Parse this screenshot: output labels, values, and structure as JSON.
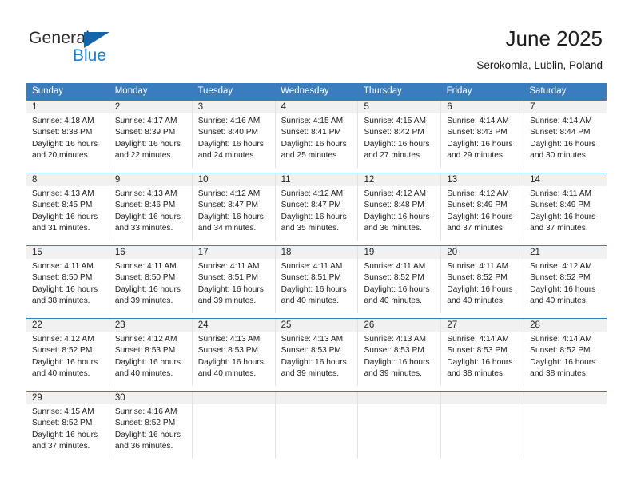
{
  "brand": {
    "name_top": "General",
    "name_bottom": "Blue",
    "triangle_color": "#1464aa",
    "blue_color": "#1a7fd4"
  },
  "header": {
    "title": "June 2025",
    "location": "Serokomla, Lublin, Poland"
  },
  "theme": {
    "header_bg": "#3a7dbf",
    "header_text": "#ffffff",
    "day_band_bg": "#f1f1f1",
    "cell_divider": "#e2e2e2"
  },
  "weekdays": [
    "Sunday",
    "Monday",
    "Tuesday",
    "Wednesday",
    "Thursday",
    "Friday",
    "Saturday"
  ],
  "weeks": [
    [
      {
        "day": "1",
        "sunrise": "Sunrise: 4:18 AM",
        "sunset": "Sunset: 8:38 PM",
        "daylight_1": "Daylight: 16 hours",
        "daylight_2": "and 20 minutes."
      },
      {
        "day": "2",
        "sunrise": "Sunrise: 4:17 AM",
        "sunset": "Sunset: 8:39 PM",
        "daylight_1": "Daylight: 16 hours",
        "daylight_2": "and 22 minutes."
      },
      {
        "day": "3",
        "sunrise": "Sunrise: 4:16 AM",
        "sunset": "Sunset: 8:40 PM",
        "daylight_1": "Daylight: 16 hours",
        "daylight_2": "and 24 minutes."
      },
      {
        "day": "4",
        "sunrise": "Sunrise: 4:15 AM",
        "sunset": "Sunset: 8:41 PM",
        "daylight_1": "Daylight: 16 hours",
        "daylight_2": "and 25 minutes."
      },
      {
        "day": "5",
        "sunrise": "Sunrise: 4:15 AM",
        "sunset": "Sunset: 8:42 PM",
        "daylight_1": "Daylight: 16 hours",
        "daylight_2": "and 27 minutes."
      },
      {
        "day": "6",
        "sunrise": "Sunrise: 4:14 AM",
        "sunset": "Sunset: 8:43 PM",
        "daylight_1": "Daylight: 16 hours",
        "daylight_2": "and 29 minutes."
      },
      {
        "day": "7",
        "sunrise": "Sunrise: 4:14 AM",
        "sunset": "Sunset: 8:44 PM",
        "daylight_1": "Daylight: 16 hours",
        "daylight_2": "and 30 minutes."
      }
    ],
    [
      {
        "day": "8",
        "sunrise": "Sunrise: 4:13 AM",
        "sunset": "Sunset: 8:45 PM",
        "daylight_1": "Daylight: 16 hours",
        "daylight_2": "and 31 minutes."
      },
      {
        "day": "9",
        "sunrise": "Sunrise: 4:13 AM",
        "sunset": "Sunset: 8:46 PM",
        "daylight_1": "Daylight: 16 hours",
        "daylight_2": "and 33 minutes."
      },
      {
        "day": "10",
        "sunrise": "Sunrise: 4:12 AM",
        "sunset": "Sunset: 8:47 PM",
        "daylight_1": "Daylight: 16 hours",
        "daylight_2": "and 34 minutes."
      },
      {
        "day": "11",
        "sunrise": "Sunrise: 4:12 AM",
        "sunset": "Sunset: 8:47 PM",
        "daylight_1": "Daylight: 16 hours",
        "daylight_2": "and 35 minutes."
      },
      {
        "day": "12",
        "sunrise": "Sunrise: 4:12 AM",
        "sunset": "Sunset: 8:48 PM",
        "daylight_1": "Daylight: 16 hours",
        "daylight_2": "and 36 minutes."
      },
      {
        "day": "13",
        "sunrise": "Sunrise: 4:12 AM",
        "sunset": "Sunset: 8:49 PM",
        "daylight_1": "Daylight: 16 hours",
        "daylight_2": "and 37 minutes."
      },
      {
        "day": "14",
        "sunrise": "Sunrise: 4:11 AM",
        "sunset": "Sunset: 8:49 PM",
        "daylight_1": "Daylight: 16 hours",
        "daylight_2": "and 37 minutes."
      }
    ],
    [
      {
        "day": "15",
        "sunrise": "Sunrise: 4:11 AM",
        "sunset": "Sunset: 8:50 PM",
        "daylight_1": "Daylight: 16 hours",
        "daylight_2": "and 38 minutes."
      },
      {
        "day": "16",
        "sunrise": "Sunrise: 4:11 AM",
        "sunset": "Sunset: 8:50 PM",
        "daylight_1": "Daylight: 16 hours",
        "daylight_2": "and 39 minutes."
      },
      {
        "day": "17",
        "sunrise": "Sunrise: 4:11 AM",
        "sunset": "Sunset: 8:51 PM",
        "daylight_1": "Daylight: 16 hours",
        "daylight_2": "and 39 minutes."
      },
      {
        "day": "18",
        "sunrise": "Sunrise: 4:11 AM",
        "sunset": "Sunset: 8:51 PM",
        "daylight_1": "Daylight: 16 hours",
        "daylight_2": "and 40 minutes."
      },
      {
        "day": "19",
        "sunrise": "Sunrise: 4:11 AM",
        "sunset": "Sunset: 8:52 PM",
        "daylight_1": "Daylight: 16 hours",
        "daylight_2": "and 40 minutes."
      },
      {
        "day": "20",
        "sunrise": "Sunrise: 4:11 AM",
        "sunset": "Sunset: 8:52 PM",
        "daylight_1": "Daylight: 16 hours",
        "daylight_2": "and 40 minutes."
      },
      {
        "day": "21",
        "sunrise": "Sunrise: 4:12 AM",
        "sunset": "Sunset: 8:52 PM",
        "daylight_1": "Daylight: 16 hours",
        "daylight_2": "and 40 minutes."
      }
    ],
    [
      {
        "day": "22",
        "sunrise": "Sunrise: 4:12 AM",
        "sunset": "Sunset: 8:52 PM",
        "daylight_1": "Daylight: 16 hours",
        "daylight_2": "and 40 minutes."
      },
      {
        "day": "23",
        "sunrise": "Sunrise: 4:12 AM",
        "sunset": "Sunset: 8:53 PM",
        "daylight_1": "Daylight: 16 hours",
        "daylight_2": "and 40 minutes."
      },
      {
        "day": "24",
        "sunrise": "Sunrise: 4:13 AM",
        "sunset": "Sunset: 8:53 PM",
        "daylight_1": "Daylight: 16 hours",
        "daylight_2": "and 40 minutes."
      },
      {
        "day": "25",
        "sunrise": "Sunrise: 4:13 AM",
        "sunset": "Sunset: 8:53 PM",
        "daylight_1": "Daylight: 16 hours",
        "daylight_2": "and 39 minutes."
      },
      {
        "day": "26",
        "sunrise": "Sunrise: 4:13 AM",
        "sunset": "Sunset: 8:53 PM",
        "daylight_1": "Daylight: 16 hours",
        "daylight_2": "and 39 minutes."
      },
      {
        "day": "27",
        "sunrise": "Sunrise: 4:14 AM",
        "sunset": "Sunset: 8:53 PM",
        "daylight_1": "Daylight: 16 hours",
        "daylight_2": "and 38 minutes."
      },
      {
        "day": "28",
        "sunrise": "Sunrise: 4:14 AM",
        "sunset": "Sunset: 8:52 PM",
        "daylight_1": "Daylight: 16 hours",
        "daylight_2": "and 38 minutes."
      }
    ],
    [
      {
        "day": "29",
        "sunrise": "Sunrise: 4:15 AM",
        "sunset": "Sunset: 8:52 PM",
        "daylight_1": "Daylight: 16 hours",
        "daylight_2": "and 37 minutes."
      },
      {
        "day": "30",
        "sunrise": "Sunrise: 4:16 AM",
        "sunset": "Sunset: 8:52 PM",
        "daylight_1": "Daylight: 16 hours",
        "daylight_2": "and 36 minutes."
      },
      {
        "day": "",
        "sunrise": "",
        "sunset": "",
        "daylight_1": "",
        "daylight_2": ""
      },
      {
        "day": "",
        "sunrise": "",
        "sunset": "",
        "daylight_1": "",
        "daylight_2": ""
      },
      {
        "day": "",
        "sunrise": "",
        "sunset": "",
        "daylight_1": "",
        "daylight_2": ""
      },
      {
        "day": "",
        "sunrise": "",
        "sunset": "",
        "daylight_1": "",
        "daylight_2": ""
      },
      {
        "day": "",
        "sunrise": "",
        "sunset": "",
        "daylight_1": "",
        "daylight_2": ""
      }
    ]
  ]
}
